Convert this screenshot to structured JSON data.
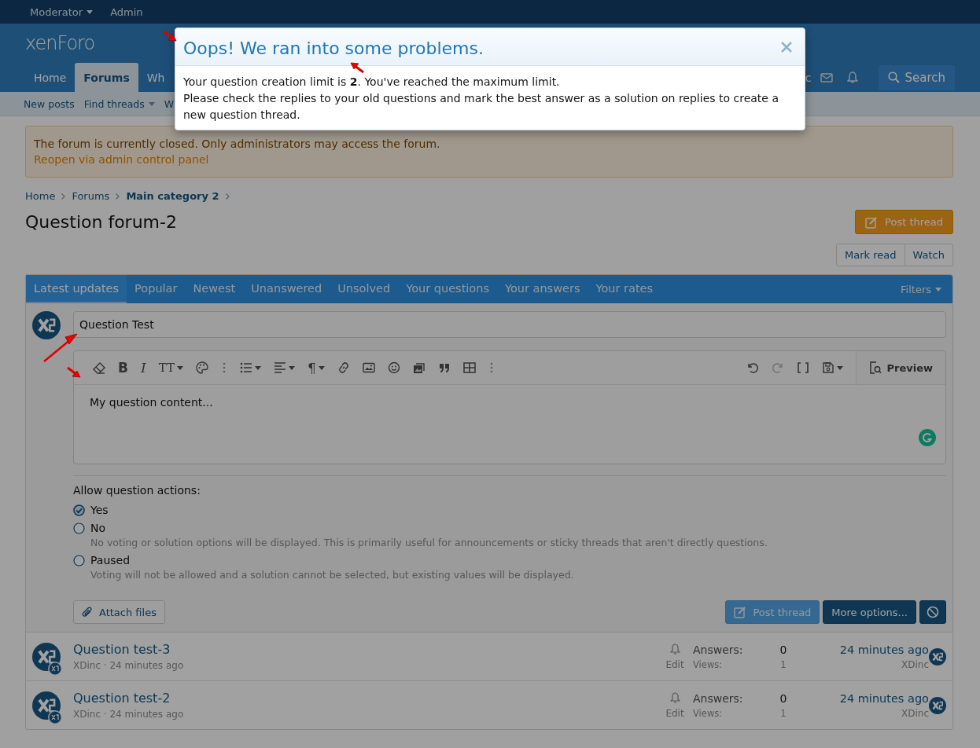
{
  "staff_bar": [
    {
      "label": "Moderator",
      "has_menu": true
    },
    {
      "label": "Admin",
      "has_menu": false
    }
  ],
  "logo": "xenForo",
  "nav": {
    "tabs": [
      {
        "label": "Home",
        "selected": false
      },
      {
        "label": "Forums",
        "selected": true
      },
      {
        "label": "Wh",
        "selected": false
      }
    ],
    "cut_text": "c",
    "search": "Search"
  },
  "subnav": [
    {
      "label": "New posts",
      "has_menu": false
    },
    {
      "label": "Find threads",
      "has_menu": true
    },
    {
      "label": "W",
      "has_menu": false
    }
  ],
  "notice": {
    "text": "The forum is currently closed. Only administrators may access the forum.",
    "link": "Reopen via admin control panel"
  },
  "breadcrumb": [
    {
      "label": "Home",
      "current": false
    },
    {
      "label": "Forums",
      "current": false
    },
    {
      "label": "Main category 2",
      "current": true
    }
  ],
  "page_title": "Question forum-2",
  "post_thread": "Post thread",
  "actions": [
    "Mark read",
    "Watch"
  ],
  "filter_tabs": [
    {
      "label": "Latest updates",
      "selected": true
    },
    {
      "label": "Popular",
      "selected": false
    },
    {
      "label": "Newest",
      "selected": false
    },
    {
      "label": "Unanswered",
      "selected": false
    },
    {
      "label": "Unsolved",
      "selected": false
    },
    {
      "label": "Your questions",
      "selected": false
    },
    {
      "label": "Your answers",
      "selected": false
    },
    {
      "label": "Your rates",
      "selected": false
    }
  ],
  "filters": "Filters",
  "form": {
    "title_value": "Question Test",
    "toolbar": [
      {
        "kind": "icon",
        "menu": false,
        "disabled": false
      },
      {
        "kind": "glyph",
        "text": "B",
        "menu": false,
        "disabled": false
      },
      {
        "kind": "glyph",
        "text": "I",
        "menu": false,
        "disabled": false
      },
      {
        "kind": "glyph",
        "text": "TT",
        "menu": true,
        "disabled": false
      },
      {
        "kind": "icon",
        "menu": false,
        "disabled": false
      },
      {
        "kind": "more",
        "menu": false,
        "disabled": false
      },
      {
        "kind": "icon",
        "menu": true,
        "disabled": false
      },
      {
        "kind": "icon",
        "menu": true,
        "disabled": false
      },
      {
        "kind": "glyph",
        "text": "¶",
        "menu": true,
        "disabled": false
      },
      {
        "kind": "icon",
        "menu": false,
        "disabled": false
      },
      {
        "kind": "icon",
        "menu": false,
        "disabled": false
      },
      {
        "kind": "icon",
        "menu": false,
        "disabled": false
      },
      {
        "kind": "icon",
        "menu": false,
        "disabled": false
      },
      {
        "kind": "icon",
        "menu": false,
        "disabled": false
      },
      {
        "kind": "icon",
        "menu": false,
        "disabled": false
      },
      {
        "kind": "more",
        "menu": false,
        "disabled": false
      }
    ],
    "toolbar_right": [
      {
        "kind": "icon",
        "menu": false,
        "disabled": false
      },
      {
        "kind": "icon",
        "menu": false,
        "disabled": true
      },
      {
        "kind": "icon",
        "menu": false,
        "disabled": false
      },
      {
        "kind": "icon",
        "menu": true,
        "disabled": false
      }
    ],
    "preview": "Preview",
    "content": "My question content...",
    "actions_label": "Allow question actions:",
    "options": [
      {
        "label": "Yes",
        "selected": true
      },
      {
        "label": "No",
        "selected": false,
        "hint": "No voting or solution options will be displayed. This is primarily useful for announcements or sticky threads that aren't directly questions."
      },
      {
        "label": "Paused",
        "selected": false,
        "hint": "Voting will not be allowed and a solution cannot be selected, but existing values will be displayed."
      }
    ],
    "attach": "Attach files",
    "submit": "Post thread",
    "more": "More options..."
  },
  "threads": [
    {
      "title": "Question test-3",
      "meta": "XDinc · 24 minutes ago",
      "edit": "Edit",
      "answers_label": "Answers:",
      "answers": "0",
      "views_label": "Views:",
      "views": "1",
      "last_time": "24 minutes ago",
      "last_user": "XDinc"
    },
    {
      "title": "Question test-2",
      "meta": "XDinc · 24 minutes ago",
      "edit": "Edit",
      "answers_label": "Answers:",
      "answers": "0",
      "views_label": "Views:",
      "views": "1",
      "last_time": "24 minutes ago",
      "last_user": "XDinc"
    }
  ],
  "dialog": {
    "title": "Oops! We ran into some problems.",
    "lines": [
      "Your question creation limit is **2**. You've reached the maximum limit.",
      "Please check the replies to your old questions and mark the best answer as a solution on replies to create a new question thread."
    ]
  }
}
